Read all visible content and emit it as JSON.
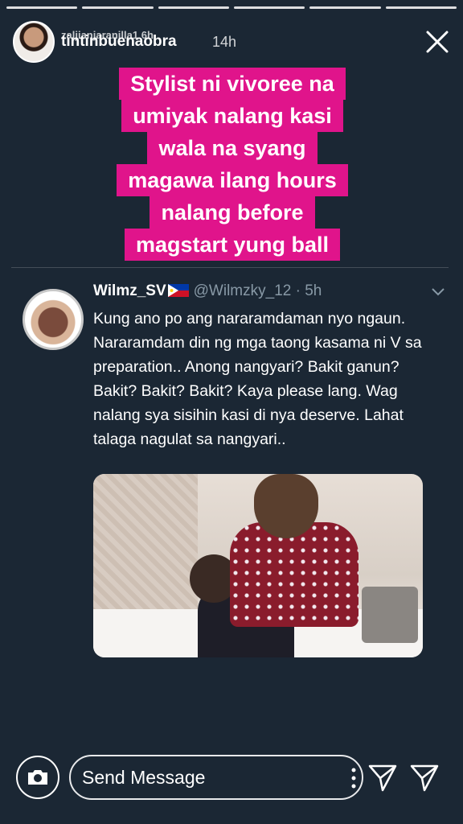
{
  "story": {
    "username_overlay": "zaljianjaranilla1",
    "username": "tintinbuenaobra",
    "overlay_time": "6h",
    "time": "14h"
  },
  "caption_lines": [
    "Stylist ni vivoree na",
    "umiyak nalang kasi",
    "wala na syang",
    "magawa ilang hours",
    "nalang before",
    "magstart yung ball"
  ],
  "tweet": {
    "display_name": "Wilmz_SV",
    "handle": "@Wilmzky_12",
    "time": "5h",
    "text": "Kung ano po ang nararamdaman nyo ngaun. Nararamdam din ng mga taong kasama ni V sa preparation.. Anong nangyari? Bakit ganun? Bakit? Bakit? Bakit? Kaya please lang. Wag nalang sya sisihin kasi di nya deserve. Lahat talaga nagulat sa nangyari.."
  },
  "footer": {
    "message_placeholder": "Send Message"
  },
  "colors": {
    "background": "#1b2734",
    "caption_highlight": "#e0148b",
    "handle_gray": "#8899a6"
  },
  "icons": [
    "close-icon",
    "philippines-flag-icon",
    "chevron-down-icon",
    "camera-icon",
    "more-icon",
    "send-icon"
  ]
}
